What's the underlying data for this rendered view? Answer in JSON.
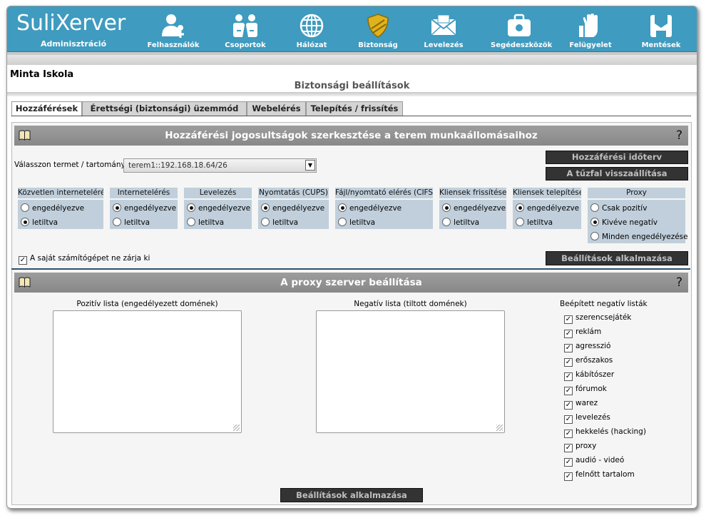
{
  "app": {
    "logo_name": "SuliXerver",
    "logo_sub": "Adminisztráció",
    "nav": [
      {
        "label": "Felhasználók",
        "icon": "users-icon"
      },
      {
        "label": "Csoportok",
        "icon": "groups-icon"
      },
      {
        "label": "Hálózat",
        "icon": "globe-icon"
      },
      {
        "label": "Biztonság",
        "icon": "shield-icon"
      },
      {
        "label": "Levelezés",
        "icon": "mail-icon"
      },
      {
        "label": "Segédeszközök",
        "icon": "toolbox-icon"
      },
      {
        "label": "Felügyelet",
        "icon": "hand-icon"
      },
      {
        "label": "Mentések",
        "icon": "backup-icon"
      }
    ]
  },
  "school": "Minta Iskola",
  "page_title": "Biztonsági beállítások",
  "tabs": [
    "Hozzáférések",
    "Érettségi (biztonsági) üzemmód",
    "Webelérés",
    "Telepítés / frissítés"
  ],
  "access": {
    "title": "Hozzáférési jogosultságok szerkesztése a terem munkaállomásaihoz",
    "help": "?",
    "select_label": "Válasszon termet / tartományt :",
    "select_value": "terem1::192.168.18.64/26",
    "btn_schedule": "Hozzáférési időterv",
    "btn_firewall_reset": "A tűzfal visszaállítása",
    "groups": [
      {
        "title": "Közvetlen internetelérés",
        "options": [
          "engedélyezve",
          "letiltva"
        ],
        "selected": 1
      },
      {
        "title": "Internetelérés",
        "options": [
          "engedélyezve",
          "letiltva"
        ],
        "selected": 0
      },
      {
        "title": "Levelezés",
        "options": [
          "engedélyezve",
          "letiltva"
        ],
        "selected": 0
      },
      {
        "title": "Nyomtatás (CUPS)",
        "options": [
          "engedélyezve",
          "letiltva"
        ],
        "selected": 0
      },
      {
        "title": "Fájl/nyomtató elérés (CIFS)",
        "options": [
          "engedélyezve",
          "letiltva"
        ],
        "selected": 0
      },
      {
        "title": "Kliensek frissítése",
        "options": [
          "engedélyezve",
          "letiltva"
        ],
        "selected": 0
      },
      {
        "title": "Kliensek telepítése",
        "options": [
          "engedélyezve",
          "letiltva"
        ],
        "selected": 0
      },
      {
        "title": "Proxy",
        "options": [
          "Csak pozitív",
          "Kivéve negatív",
          "Minden engedélyezése"
        ],
        "selected": 1
      }
    ],
    "lock_label": "A saját számítógépet ne zárja ki",
    "lock_checked": true,
    "btn_apply": "Beállítások alkalmazása"
  },
  "proxy": {
    "title": "A proxy szerver beállítása",
    "help": "?",
    "positive_label": "Pozitív lista (engedélyezett domének)",
    "positive_value": "",
    "negative_label": "Negatív lista (tiltott domének)",
    "negative_value": "",
    "builtin_label": "Beépített negatív listák",
    "builtin": [
      {
        "label": "szerencsejáték",
        "checked": true
      },
      {
        "label": "reklám",
        "checked": true
      },
      {
        "label": "agresszió",
        "checked": true
      },
      {
        "label": "erőszakos",
        "checked": true
      },
      {
        "label": "kábítószer",
        "checked": true
      },
      {
        "label": "fórumok",
        "checked": true
      },
      {
        "label": "warez",
        "checked": true
      },
      {
        "label": "levelezés",
        "checked": true
      },
      {
        "label": "hekkelés (hacking)",
        "checked": true
      },
      {
        "label": "proxy",
        "checked": true
      },
      {
        "label": "audió - videó",
        "checked": true
      },
      {
        "label": "felnőtt tartalom",
        "checked": true
      }
    ],
    "btn_apply": "Beállítások alkalmazása"
  }
}
